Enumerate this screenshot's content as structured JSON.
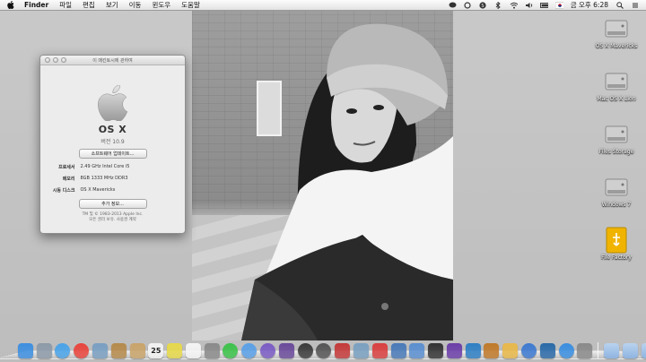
{
  "menubar": {
    "app_name": "Finder",
    "items": [
      "파일",
      "편집",
      "보기",
      "이동",
      "윈도우",
      "도움말"
    ],
    "clock": "금 오후 6:28",
    "status_icons": [
      "chat-icon",
      "circle-icon",
      "skype-icon",
      "bluetooth-icon",
      "wifi-icon",
      "volume-icon",
      "battery-icon",
      "flag-korea-icon",
      "search-icon",
      "list-icon"
    ]
  },
  "about_window": {
    "title": "이 매킨토시에 관하여",
    "os_name": "OS X",
    "version": "버전 10.9",
    "update_button": "소프트웨어 업데이트...",
    "specs": [
      {
        "label": "프로세서",
        "value": "2.49 GHz Intel Core i5"
      },
      {
        "label": "메모리",
        "value": "8GB 1333 MHz DDR3"
      },
      {
        "label": "시동 디스크",
        "value": "OS X Mavericks"
      }
    ],
    "more_info_button": "추가 정보...",
    "copyright_line1": "TM 및 © 1983-2013 Apple Inc.",
    "copyright_line2": "모든 권리 보유.  사용권 계약"
  },
  "desktop_icons": [
    {
      "label": "OS X Mavericks",
      "type": "hdd"
    },
    {
      "label": "Mac OS X Lion",
      "type": "hdd"
    },
    {
      "label": "Files Storage",
      "type": "hdd"
    },
    {
      "label": "Windows 7",
      "type": "hdd"
    },
    {
      "label": "File Factory",
      "type": "usb"
    }
  ],
  "dock": {
    "apps": [
      {
        "name": "finder-icon",
        "color": "#3d8fe0"
      },
      {
        "name": "launchpad-icon",
        "color": "#8d9aa8"
      },
      {
        "name": "safari-icon",
        "color": "#4aa3e8"
      },
      {
        "name": "chrome-icon",
        "color": "#e8453c"
      },
      {
        "name": "mail-icon",
        "color": "#7a9fc2"
      },
      {
        "name": "notes-icon",
        "color": "#b58a4c"
      },
      {
        "name": "contacts-icon",
        "color": "#c9a46a"
      },
      {
        "name": "calendar-icon",
        "color": "#f2f2f2"
      },
      {
        "name": "stickies-icon",
        "color": "#e6d84a"
      },
      {
        "name": "reminders-icon",
        "color": "#f4f4f4"
      },
      {
        "name": "photo-booth-icon",
        "color": "#8a8a8a"
      },
      {
        "name": "line-icon",
        "color": "#3cc24a"
      },
      {
        "name": "messages-icon",
        "color": "#5aa0e6"
      },
      {
        "name": "viber-icon",
        "color": "#7b5cc4"
      },
      {
        "name": "imovie-icon",
        "color": "#6a4a9a"
      },
      {
        "name": "camera-icon",
        "color": "#3a3a3a"
      },
      {
        "name": "dvd-player-icon",
        "color": "#555555"
      },
      {
        "name": "photo-icon",
        "color": "#c43a3a"
      },
      {
        "name": "preview-icon",
        "color": "#7aa0c0"
      },
      {
        "name": "font-book-icon",
        "color": "#d94040"
      },
      {
        "name": "app-icon",
        "color": "#4a7ab8"
      },
      {
        "name": "download-icon",
        "color": "#5a8fd0"
      },
      {
        "name": "instruments-icon",
        "color": "#333333"
      },
      {
        "name": "imovie-star-icon",
        "color": "#6b3ea8"
      },
      {
        "name": "aperture-icon",
        "color": "#2e7fc4"
      },
      {
        "name": "garageband-icon",
        "color": "#c07a2a"
      },
      {
        "name": "stocks-icon",
        "color": "#e8b84a"
      },
      {
        "name": "itunes-icon",
        "color": "#3d7ad0"
      },
      {
        "name": "iphoto-icon",
        "color": "#2a6aa8"
      },
      {
        "name": "app-store-icon",
        "color": "#3a8ee0"
      },
      {
        "name": "system-preferences-icon",
        "color": "#8a8a8a"
      }
    ],
    "stacks": [
      {
        "name": "applications-folder-icon",
        "color": "#8fb4e0"
      },
      {
        "name": "documents-folder-icon",
        "color": "#8fb4e0"
      },
      {
        "name": "downloads-folder-icon",
        "color": "#8fb4e0"
      }
    ],
    "calendar_day": "25"
  }
}
